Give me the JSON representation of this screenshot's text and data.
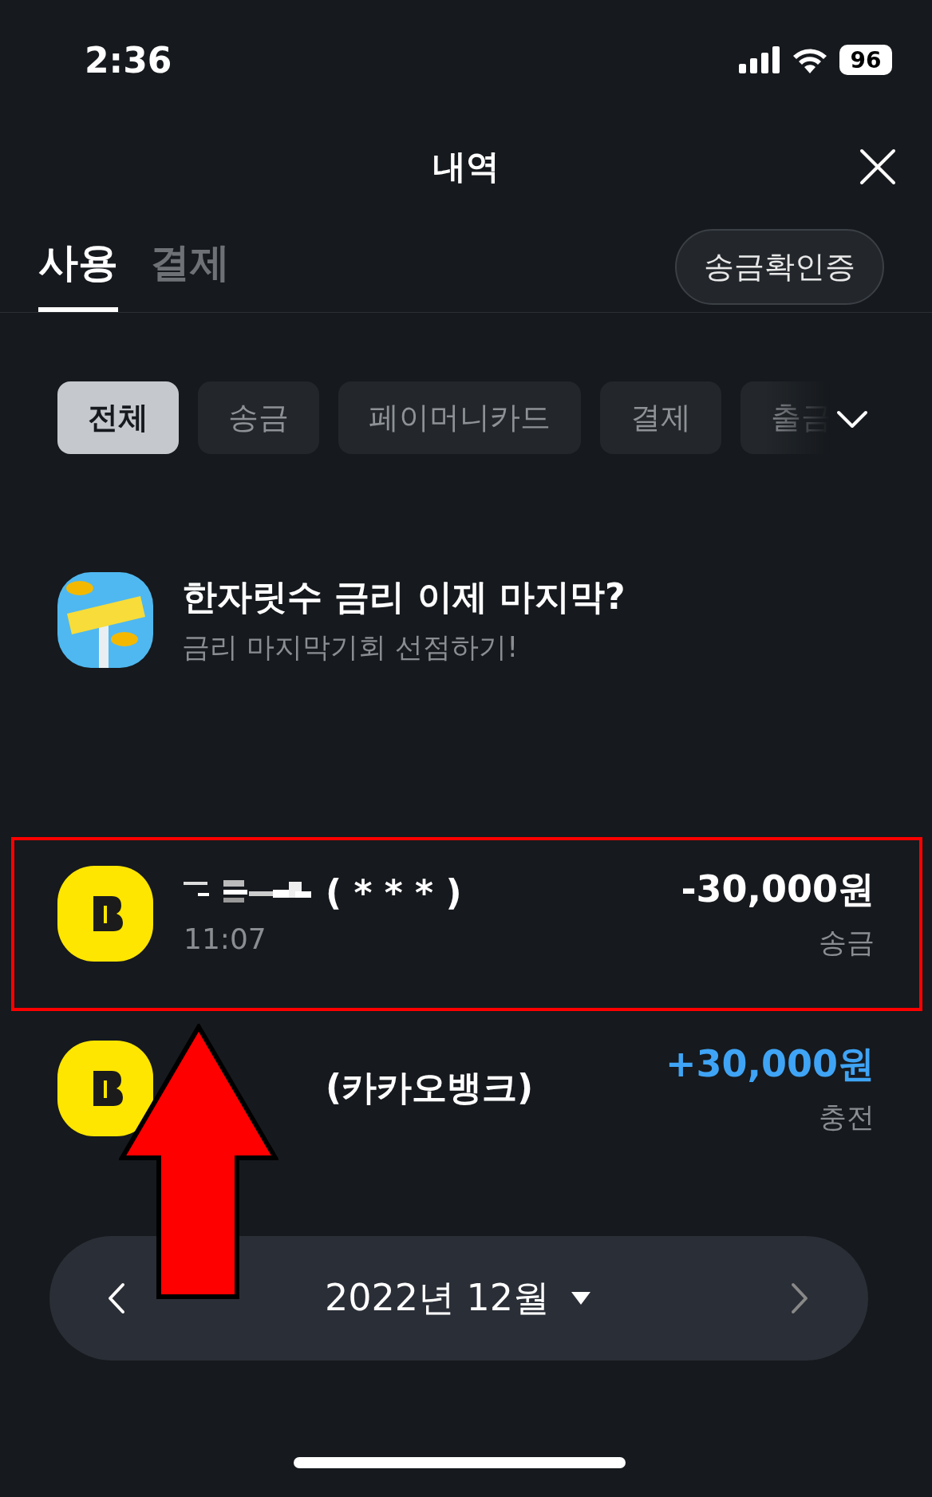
{
  "status_bar": {
    "time": "2:36",
    "battery": "96"
  },
  "header": {
    "title": "내역"
  },
  "tabs": [
    {
      "label": "사용",
      "selected": true
    },
    {
      "label": "결제",
      "selected": false
    }
  ],
  "certificate_button": "송금확인증",
  "filters": [
    {
      "label": "전체",
      "selected": true
    },
    {
      "label": "송금",
      "selected": false
    },
    {
      "label": "페이머니카드",
      "selected": false
    },
    {
      "label": "결제",
      "selected": false
    },
    {
      "label": "출금",
      "selected": false
    }
  ],
  "banner": {
    "title": "한자릿수 금리 이제 마지막?",
    "subtitle": "금리 마지막기회 선점하기!"
  },
  "transactions": [
    {
      "name_redacted": true,
      "name": "( * * * )",
      "time": "11:07",
      "amount": "-30,000원",
      "type": "송금",
      "kind": "outgoing"
    },
    {
      "name_redacted": false,
      "name": "(카카오뱅크)",
      "amount": "+30,000원",
      "type": "충전",
      "kind": "incoming"
    }
  ],
  "month_picker": {
    "label": "2022년 12월"
  }
}
